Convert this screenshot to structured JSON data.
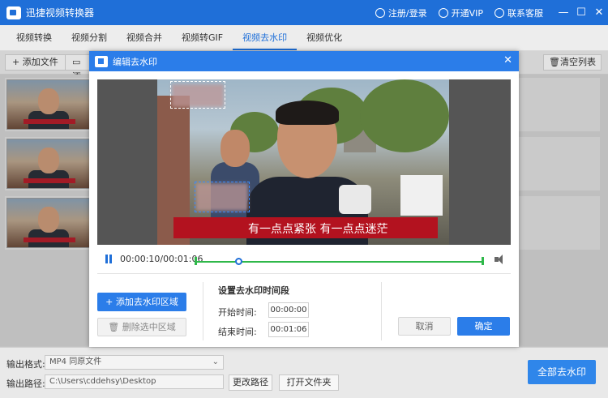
{
  "app": {
    "title": "迅捷视频转换器",
    "register_login": "注册/登录",
    "vip": "开通VIP",
    "support": "联系客服",
    "window_controls": {
      "minimize": "—",
      "restore": "☐",
      "close": "✕"
    }
  },
  "nav": {
    "tabs": [
      "视频转换",
      "视频分割",
      "视频合并",
      "视频转GIF",
      "视频去水印",
      "视频优化"
    ],
    "active_tab": "视频去水印"
  },
  "toolbar": {
    "add_file": "+ 添加文件",
    "add_folder_partial": "添",
    "clear_list": "清空列表"
  },
  "dialog": {
    "title": "编辑去水印",
    "close": "✕",
    "caption": "有一点点紧张 有一点点迷茫",
    "time_display": "00:00:10/00:01:06",
    "add_region": "+   添加去水印区域",
    "delete_region": "删除选中区域",
    "section_title": "设置去水印时间段",
    "start_label": "开始时间:",
    "start_value": "00:00:00",
    "end_label": "结束时间:",
    "end_value": "00:01:06",
    "cancel": "取消",
    "confirm": "确定",
    "playhead_fraction": 0.152
  },
  "bottom": {
    "format_label": "输出格式:",
    "format_value": "MP4  同原文件",
    "path_label": "输出路径:",
    "path_value": "C:\\Users\\cddehsy\\Desktop",
    "change_path": "更改路径",
    "open_folder": "打开文件夹",
    "remove_all": "全部去水印"
  },
  "colors": {
    "brand_blue": "#1f6fd8",
    "button_blue": "#2b7de9",
    "track_green": "#2fb84a",
    "caption_red": "#b3121f"
  }
}
